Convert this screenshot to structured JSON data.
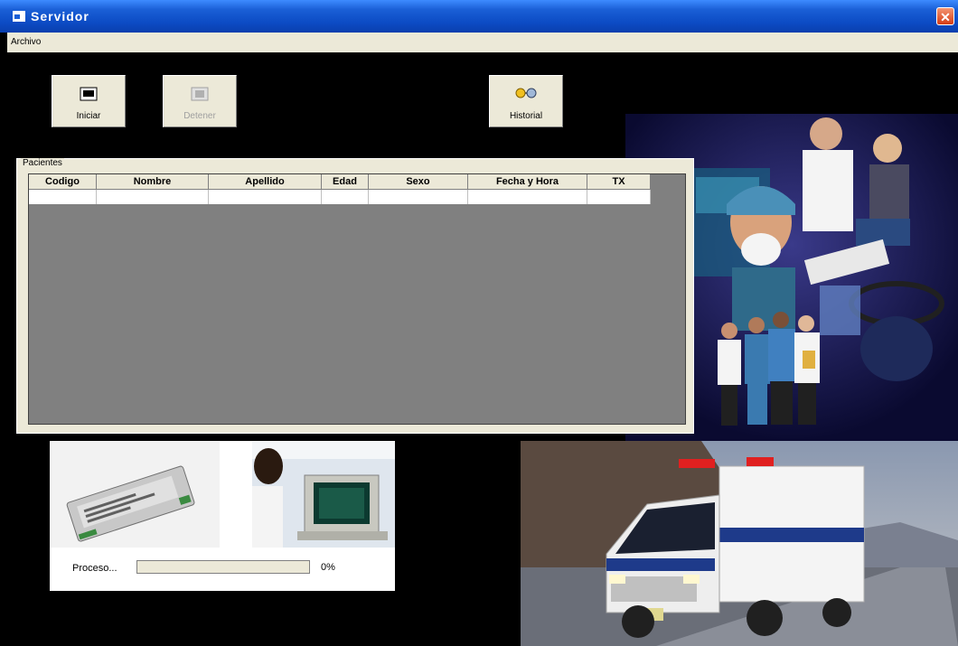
{
  "window": {
    "title": "Servidor",
    "close_symbol": "✕"
  },
  "menu": {
    "items": [
      "Archivo"
    ]
  },
  "toolbar": {
    "start_label": "Iniciar",
    "stop_label": "Detener",
    "history_label": "Historial"
  },
  "patients": {
    "frame_title": "Pacientes",
    "columns": [
      "Codigo",
      "Nombre",
      "Apellido",
      "Edad",
      "Sexo",
      "Fecha y Hora",
      "TX"
    ],
    "rows": [
      [
        "",
        "",
        "",
        "",
        "",
        "",
        ""
      ]
    ]
  },
  "process": {
    "label": "Proceso...",
    "percent_text": "0%",
    "progress": 0
  },
  "icons": {
    "title": "window-app-icon",
    "start": "start-icon",
    "stop": "stop-icon",
    "history": "history-glasses-icon"
  },
  "colors": {
    "titlebar": "#0c4bc4",
    "menubar": "#ece9d8",
    "client_bg": "#000000",
    "grid_bg": "#808080"
  }
}
